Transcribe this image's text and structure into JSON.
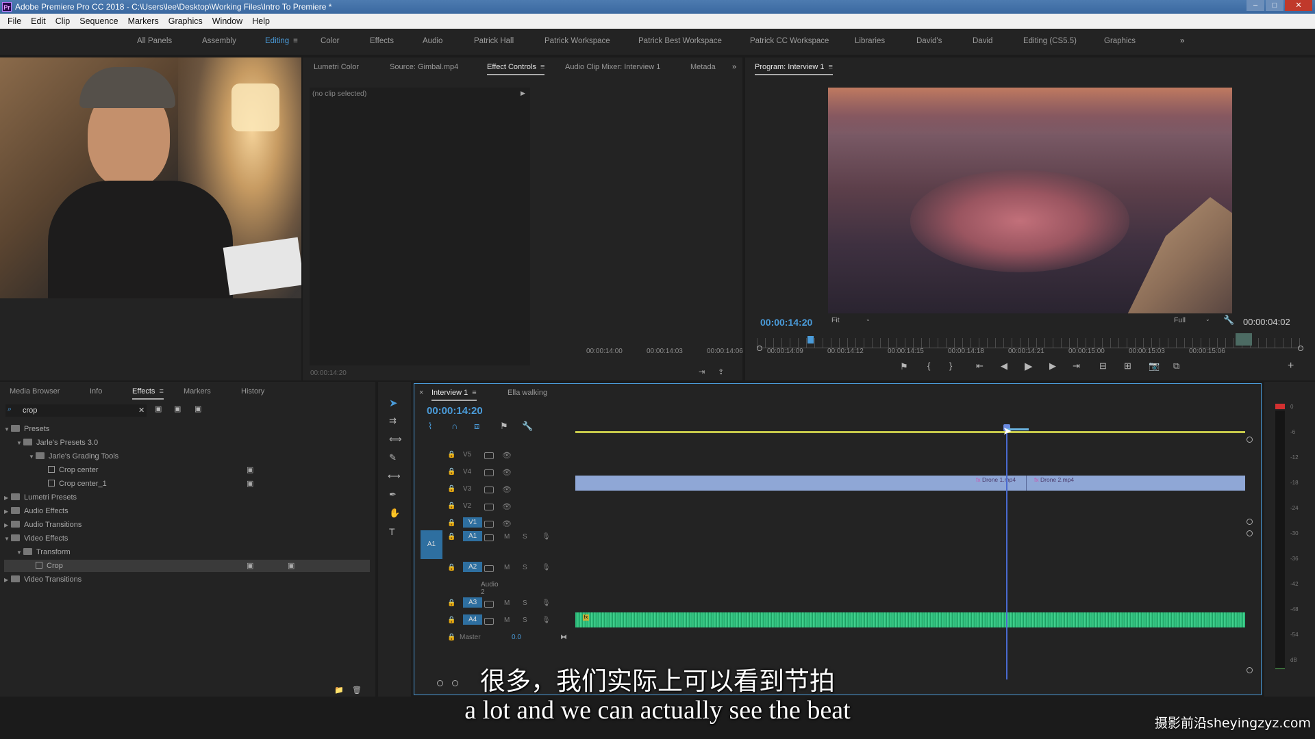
{
  "window": {
    "title": "Adobe Premiere Pro CC 2018 - C:\\Users\\lee\\Desktop\\Working Files\\Intro To Premiere *",
    "app_icon": "Pr"
  },
  "menu": [
    "File",
    "Edit",
    "Clip",
    "Sequence",
    "Markers",
    "Graphics",
    "Window",
    "Help"
  ],
  "workspaces": {
    "items": [
      "All Panels",
      "Assembly",
      "Editing",
      "Color",
      "Effects",
      "Audio",
      "Patrick Hall",
      "Patrick Workspace",
      "Patrick Best Workspace",
      "Patrick CC Workspace",
      "Libraries",
      "David's",
      "David",
      "Editing (CS5.5)",
      "Graphics"
    ],
    "active": "Editing",
    "overflow": "»"
  },
  "source_panel": {
    "tabs": [
      "Lumetri Color",
      "Source: Gimbal.mp4",
      "Effect Controls",
      "Audio Clip Mixer: Interview 1",
      "Metada"
    ],
    "active_tab": "Effect Controls",
    "no_clip": "(no clip selected)",
    "timecode": "00:00:14:20",
    "overflow": "»"
  },
  "program_monitor": {
    "title": "Program: Interview 1",
    "timecode": "00:00:14:20",
    "fit": "Fit",
    "quality": "Full",
    "duration": "00:00:04:02"
  },
  "project_panel": {
    "tabs": [
      "Media Browser",
      "Info",
      "Effects",
      "Markers",
      "History"
    ],
    "active_tab": "Effects",
    "search_value": "crop",
    "tree": [
      {
        "label": "Presets",
        "level": 0,
        "type": "folder",
        "open": true
      },
      {
        "label": "Jarle's Presets 3.0",
        "level": 1,
        "type": "folder",
        "open": true
      },
      {
        "label": "Jarle's Grading Tools",
        "level": 2,
        "type": "folder",
        "open": true
      },
      {
        "label": "Crop center",
        "level": 3,
        "type": "preset"
      },
      {
        "label": "Crop center_1",
        "level": 3,
        "type": "preset"
      },
      {
        "label": "Lumetri Presets",
        "level": 0,
        "type": "folder",
        "open": false
      },
      {
        "label": "Audio Effects",
        "level": 0,
        "type": "folder",
        "open": false
      },
      {
        "label": "Audio Transitions",
        "level": 0,
        "type": "folder",
        "open": false
      },
      {
        "label": "Video Effects",
        "level": 0,
        "type": "folder",
        "open": true
      },
      {
        "label": "Transform",
        "level": 1,
        "type": "folder",
        "open": true
      },
      {
        "label": "Crop",
        "level": 2,
        "type": "preset",
        "selected": true
      },
      {
        "label": "Video Transitions",
        "level": 0,
        "type": "folder",
        "open": false
      }
    ]
  },
  "timeline": {
    "tabs": [
      "Interview 1",
      "Ella walking"
    ],
    "active_tab": "Interview 1",
    "timecode": "00:00:14:20",
    "ruler": [
      "00:00:14:00",
      "00:00:14:03",
      "00:00:14:06",
      "00:00:14:09",
      "00:00:14:12",
      "00:00:14:15",
      "00:00:14:18",
      "00:00:14:21",
      "00:00:15:00",
      "00:00:15:03",
      "00:00:15:06"
    ],
    "video_tracks": [
      "V5",
      "V4",
      "V3",
      "V2",
      "V1"
    ],
    "audio_tracks": [
      "A1",
      "A2",
      "A3",
      "A4"
    ],
    "audio2_name": "Audio 2",
    "mute": "M",
    "solo": "S",
    "master_label": "Master",
    "master_value": "0.0",
    "source_patch_a": "A1",
    "clips": [
      {
        "name": "Drone 1.mp4",
        "track": "V3"
      },
      {
        "name": "Drone 2.mp4",
        "track": "V3"
      }
    ],
    "clip_color": "#8fa7d6",
    "audio_color": "#2fbf7e"
  },
  "meter": {
    "labels": [
      "0",
      "-6",
      "-12",
      "-18",
      "-24",
      "-30",
      "-36",
      "-42",
      "-48",
      "-54",
      "dB"
    ]
  },
  "subtitles": {
    "chinese": "很多，我们实际上可以看到节拍",
    "english": "a lot and we can actually see the beat"
  },
  "watermark": "摄影前沿sheyingzyz.com"
}
